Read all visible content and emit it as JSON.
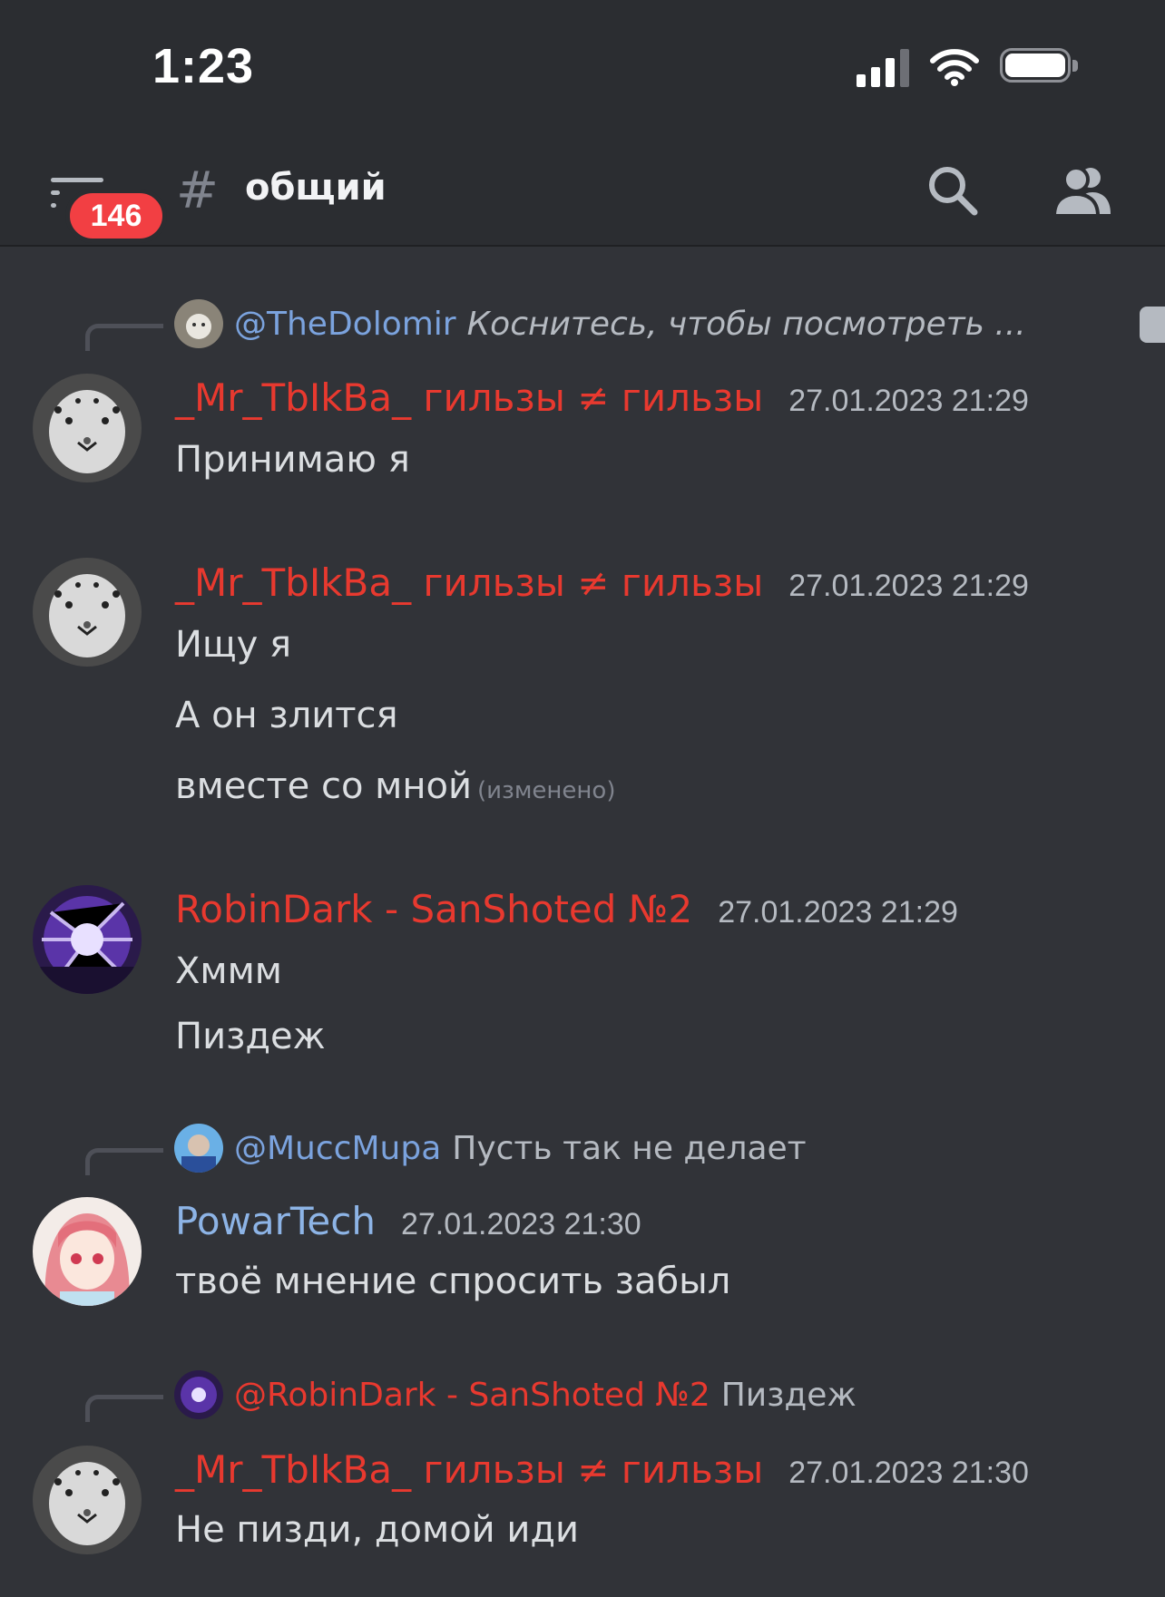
{
  "status_bar": {
    "time": "1:23"
  },
  "header": {
    "unread_badge": "146",
    "channel_hash": "#",
    "channel_name": "общий"
  },
  "colors": {
    "red_role": "#e8392f",
    "blue_role": "#8db4e6",
    "mention_blue": "#7ba3de",
    "background": "#313338",
    "header_bg": "#2b2d31"
  },
  "messages": [
    {
      "reply": {
        "mention": "@TheDolomir",
        "preview": "Коснитесь, чтобы посмотреть ..."
      },
      "author": "_Mr_TbIkBa_ гильзы ≠ гильзы",
      "timestamp": "27.01.2023 21:29",
      "lines": [
        "Принимаю я"
      ]
    },
    {
      "author": "_Mr_TbIkBa_ гильзы ≠ гильзы",
      "timestamp": "27.01.2023 21:29",
      "lines": [
        "Ищу я",
        "А он злится",
        "вместе со мной"
      ],
      "edited_label": "(изменено)"
    },
    {
      "author": "RobinDark - SanShoted №2",
      "timestamp": "27.01.2023 21:29",
      "lines": [
        "Хммм",
        "Пиздеж"
      ]
    },
    {
      "reply": {
        "mention": "@MuccMupa",
        "preview": "Пусть так не делает"
      },
      "author": "PowarTech",
      "timestamp": "27.01.2023 21:30",
      "lines": [
        "твоё мнение спросить забыл"
      ]
    },
    {
      "reply": {
        "mention": "@RobinDark - SanShoted №2",
        "preview": "Пиздеж"
      },
      "author": "_Mr_TbIkBa_ гильзы ≠ гильзы",
      "timestamp": "27.01.2023 21:30",
      "lines": [
        "Не пизди, домой иди"
      ]
    }
  ]
}
